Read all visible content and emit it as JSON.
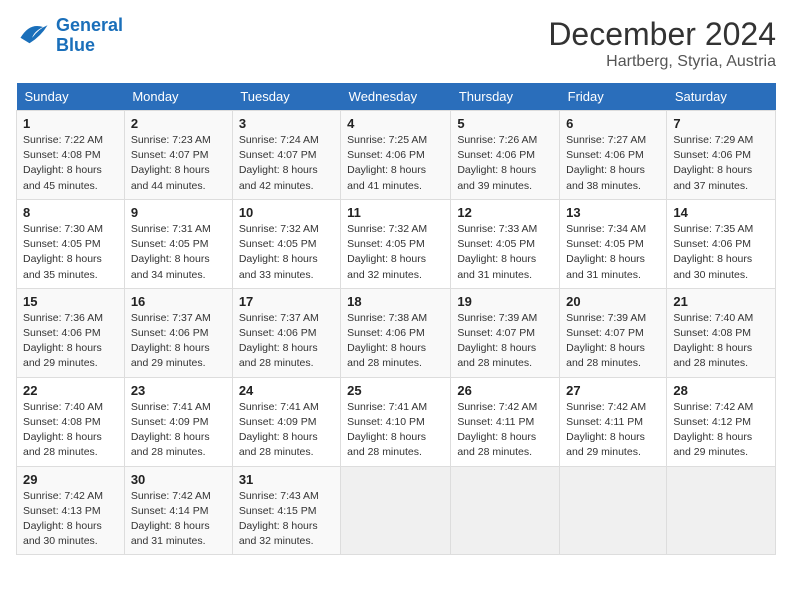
{
  "logo": {
    "line1": "General",
    "line2": "Blue"
  },
  "title": "December 2024",
  "location": "Hartberg, Styria, Austria",
  "days_of_week": [
    "Sunday",
    "Monday",
    "Tuesday",
    "Wednesday",
    "Thursday",
    "Friday",
    "Saturday"
  ],
  "weeks": [
    [
      {
        "day": "1",
        "info": "Sunrise: 7:22 AM\nSunset: 4:08 PM\nDaylight: 8 hours and 45 minutes."
      },
      {
        "day": "2",
        "info": "Sunrise: 7:23 AM\nSunset: 4:07 PM\nDaylight: 8 hours and 44 minutes."
      },
      {
        "day": "3",
        "info": "Sunrise: 7:24 AM\nSunset: 4:07 PM\nDaylight: 8 hours and 42 minutes."
      },
      {
        "day": "4",
        "info": "Sunrise: 7:25 AM\nSunset: 4:06 PM\nDaylight: 8 hours and 41 minutes."
      },
      {
        "day": "5",
        "info": "Sunrise: 7:26 AM\nSunset: 4:06 PM\nDaylight: 8 hours and 39 minutes."
      },
      {
        "day": "6",
        "info": "Sunrise: 7:27 AM\nSunset: 4:06 PM\nDaylight: 8 hours and 38 minutes."
      },
      {
        "day": "7",
        "info": "Sunrise: 7:29 AM\nSunset: 4:06 PM\nDaylight: 8 hours and 37 minutes."
      }
    ],
    [
      {
        "day": "8",
        "info": "Sunrise: 7:30 AM\nSunset: 4:05 PM\nDaylight: 8 hours and 35 minutes."
      },
      {
        "day": "9",
        "info": "Sunrise: 7:31 AM\nSunset: 4:05 PM\nDaylight: 8 hours and 34 minutes."
      },
      {
        "day": "10",
        "info": "Sunrise: 7:32 AM\nSunset: 4:05 PM\nDaylight: 8 hours and 33 minutes."
      },
      {
        "day": "11",
        "info": "Sunrise: 7:32 AM\nSunset: 4:05 PM\nDaylight: 8 hours and 32 minutes."
      },
      {
        "day": "12",
        "info": "Sunrise: 7:33 AM\nSunset: 4:05 PM\nDaylight: 8 hours and 31 minutes."
      },
      {
        "day": "13",
        "info": "Sunrise: 7:34 AM\nSunset: 4:05 PM\nDaylight: 8 hours and 31 minutes."
      },
      {
        "day": "14",
        "info": "Sunrise: 7:35 AM\nSunset: 4:06 PM\nDaylight: 8 hours and 30 minutes."
      }
    ],
    [
      {
        "day": "15",
        "info": "Sunrise: 7:36 AM\nSunset: 4:06 PM\nDaylight: 8 hours and 29 minutes."
      },
      {
        "day": "16",
        "info": "Sunrise: 7:37 AM\nSunset: 4:06 PM\nDaylight: 8 hours and 29 minutes."
      },
      {
        "day": "17",
        "info": "Sunrise: 7:37 AM\nSunset: 4:06 PM\nDaylight: 8 hours and 28 minutes."
      },
      {
        "day": "18",
        "info": "Sunrise: 7:38 AM\nSunset: 4:06 PM\nDaylight: 8 hours and 28 minutes."
      },
      {
        "day": "19",
        "info": "Sunrise: 7:39 AM\nSunset: 4:07 PM\nDaylight: 8 hours and 28 minutes."
      },
      {
        "day": "20",
        "info": "Sunrise: 7:39 AM\nSunset: 4:07 PM\nDaylight: 8 hours and 28 minutes."
      },
      {
        "day": "21",
        "info": "Sunrise: 7:40 AM\nSunset: 4:08 PM\nDaylight: 8 hours and 28 minutes."
      }
    ],
    [
      {
        "day": "22",
        "info": "Sunrise: 7:40 AM\nSunset: 4:08 PM\nDaylight: 8 hours and 28 minutes."
      },
      {
        "day": "23",
        "info": "Sunrise: 7:41 AM\nSunset: 4:09 PM\nDaylight: 8 hours and 28 minutes."
      },
      {
        "day": "24",
        "info": "Sunrise: 7:41 AM\nSunset: 4:09 PM\nDaylight: 8 hours and 28 minutes."
      },
      {
        "day": "25",
        "info": "Sunrise: 7:41 AM\nSunset: 4:10 PM\nDaylight: 8 hours and 28 minutes."
      },
      {
        "day": "26",
        "info": "Sunrise: 7:42 AM\nSunset: 4:11 PM\nDaylight: 8 hours and 28 minutes."
      },
      {
        "day": "27",
        "info": "Sunrise: 7:42 AM\nSunset: 4:11 PM\nDaylight: 8 hours and 29 minutes."
      },
      {
        "day": "28",
        "info": "Sunrise: 7:42 AM\nSunset: 4:12 PM\nDaylight: 8 hours and 29 minutes."
      }
    ],
    [
      {
        "day": "29",
        "info": "Sunrise: 7:42 AM\nSunset: 4:13 PM\nDaylight: 8 hours and 30 minutes."
      },
      {
        "day": "30",
        "info": "Sunrise: 7:42 AM\nSunset: 4:14 PM\nDaylight: 8 hours and 31 minutes."
      },
      {
        "day": "31",
        "info": "Sunrise: 7:43 AM\nSunset: 4:15 PM\nDaylight: 8 hours and 32 minutes."
      },
      {
        "day": "",
        "info": ""
      },
      {
        "day": "",
        "info": ""
      },
      {
        "day": "",
        "info": ""
      },
      {
        "day": "",
        "info": ""
      }
    ]
  ]
}
